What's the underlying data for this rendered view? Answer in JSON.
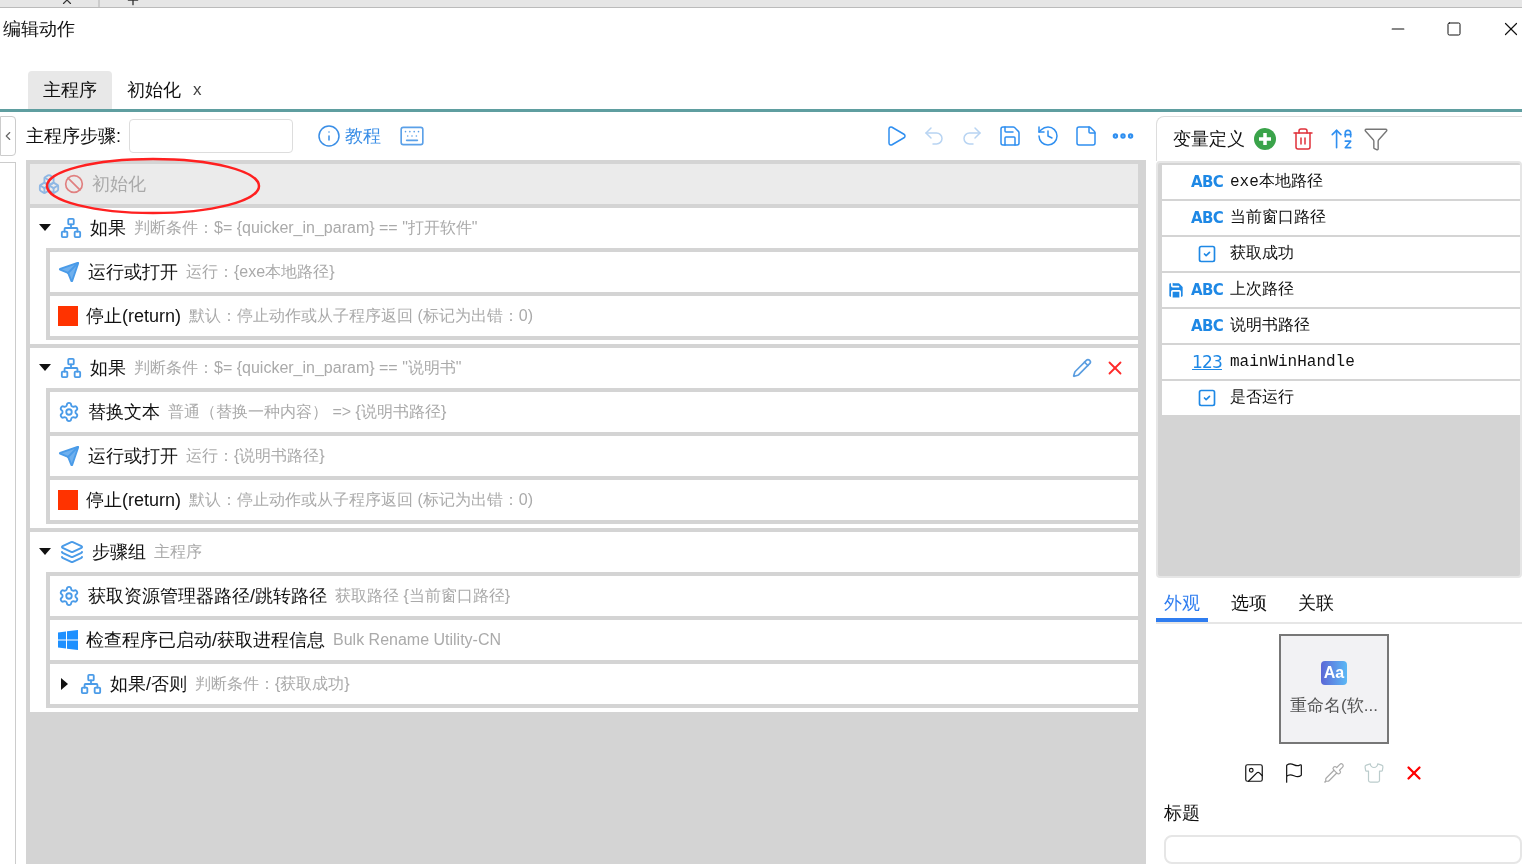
{
  "window": {
    "title": "编辑动作"
  },
  "tabs": [
    {
      "label": "主程序",
      "selected": true
    },
    {
      "label": "初始化",
      "selected": false,
      "close_label": "x"
    }
  ],
  "toolbar": {
    "label": "主程序步骤:",
    "tutorial": "教程"
  },
  "steps": [
    {
      "kind": "init",
      "title": "初始化",
      "disabled": true
    },
    {
      "kind": "if",
      "title": "如果",
      "detail": "判断条件：$= {quicker_in_param} == \"打开软件\"",
      "expanded": true,
      "actions_shown": false,
      "children": [
        {
          "kind": "run",
          "title": "运行或打开",
          "detail": "运行：{exe本地路径}"
        },
        {
          "kind": "stop",
          "title": "停止(return)",
          "detail": "默认：停止动作或从子程序返回 (标记为出错：0)"
        }
      ]
    },
    {
      "kind": "if",
      "title": "如果",
      "detail": "判断条件：$= {quicker_in_param} == \"说明书\"",
      "expanded": true,
      "actions_shown": true,
      "children": [
        {
          "kind": "replace",
          "title": "替换文本",
          "detail": "普通（替换一种内容） => {说明书路径}"
        },
        {
          "kind": "run",
          "title": "运行或打开",
          "detail": "运行：{说明书路径}"
        },
        {
          "kind": "stop",
          "title": "停止(return)",
          "detail": "默认：停止动作或从子程序返回 (标记为出错：0)"
        }
      ]
    },
    {
      "kind": "group",
      "title": "步骤组",
      "detail": "主程序",
      "expanded": true,
      "actions_shown": false,
      "children": [
        {
          "kind": "replace",
          "title": "获取资源管理器路径/跳转路径",
          "detail": "获取路径 {当前窗口路径}"
        },
        {
          "kind": "process",
          "title": "检查程序已启动/获取进程信息",
          "detail": "Bulk Rename Utility-CN"
        },
        {
          "kind": "if",
          "title": "如果/否则",
          "detail": "判断条件：{获取成功}",
          "expanded": false,
          "actions_shown": false
        }
      ]
    }
  ],
  "variables": {
    "title": "变量定义",
    "items": [
      {
        "kind": "text",
        "type_label": "ABC",
        "name": "exe本地路径",
        "saved": false
      },
      {
        "kind": "text",
        "type_label": "ABC",
        "name": "当前窗口路径",
        "saved": false
      },
      {
        "kind": "bool",
        "name": "获取成功",
        "saved": false
      },
      {
        "kind": "text",
        "type_label": "ABC",
        "name": "上次路径",
        "saved": true
      },
      {
        "kind": "text",
        "type_label": "ABC",
        "name": "说明书路径",
        "saved": false
      },
      {
        "kind": "number",
        "type_label": "123",
        "name": "mainWinHandle",
        "saved": false
      },
      {
        "kind": "bool",
        "name": "是否运行",
        "saved": false
      }
    ]
  },
  "props_tabs": [
    {
      "label": "外观",
      "selected": true
    },
    {
      "label": "选项",
      "selected": false
    },
    {
      "label": "关联",
      "selected": false
    }
  ],
  "appearance": {
    "icon_text": "Aa",
    "name": "重命名(软...",
    "title_label": "标题"
  }
}
